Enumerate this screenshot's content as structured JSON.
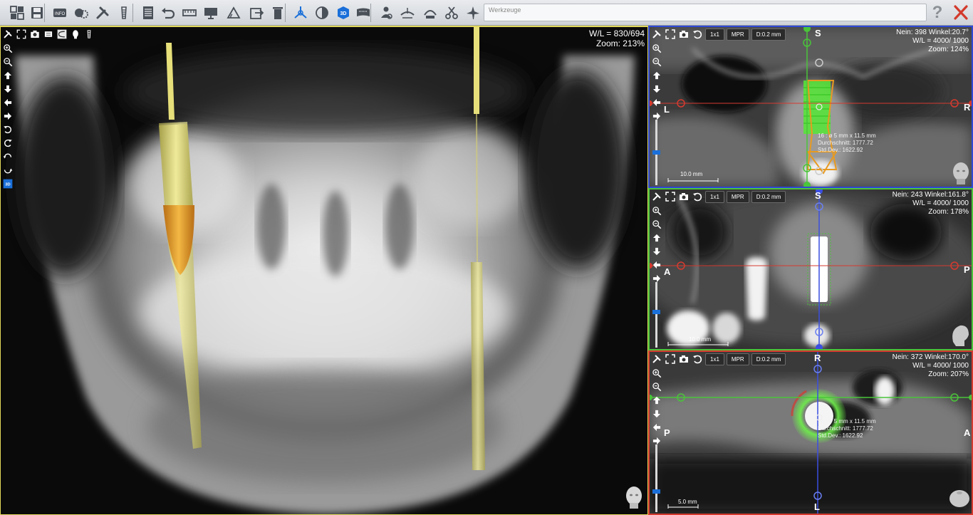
{
  "toolbar": {
    "icons": [
      "layout-icon",
      "save-icon",
      "info-icon",
      "settings-icon",
      "tools-icon",
      "implant-icon",
      "report-icon",
      "undo-icon",
      "ruler-icon",
      "screen-icon",
      "angle-icon",
      "export-icon",
      "delete-icon",
      "axis-3d-icon",
      "contrast-icon",
      "cube-3d-icon",
      "panorama-icon",
      "person-settings-icon",
      "nerve-icon",
      "camera-settings-icon",
      "scissors-icon",
      "airway-icon"
    ],
    "search_placeholder": "Werkzeuge",
    "help_label": "?"
  },
  "panorama": {
    "wl_text": "W/L = 830/694",
    "zoom_text": "Zoom: 213%",
    "tools": [
      "tools-icon",
      "fullscreen-icon",
      "camera-icon",
      "slab-icon",
      "curve-icon",
      "head-front-icon",
      "implant-small-icon"
    ],
    "side_tools": [
      "zoom-in-icon",
      "zoom-out-icon",
      "arrow-up-icon",
      "arrow-down-icon",
      "arrow-left-icon",
      "arrow-right-icon",
      "rotate-ccw-icon",
      "rotate-cw-icon",
      "rotate-ccw-alt-icon",
      "rotate-cw-alt-icon",
      "view-3d-icon"
    ]
  },
  "viewports": {
    "coronal": {
      "chips": [
        "1x1",
        "MPR",
        "D:0.2 mm"
      ],
      "info": [
        "Nein: 398 Winkel:20.7°",
        "W/L = 4000/ 1000",
        "Zoom: 124%"
      ],
      "orient_top": "S",
      "orient_left": "L",
      "orient_right": "R",
      "annotation": [
        "16 : ø 5 mm x 11.5 mm",
        "Durchschnitt: 1777.72",
        "Std.Dev.: 1622.92"
      ],
      "scale_label": "10.0 mm"
    },
    "sagittal": {
      "chips": [
        "1x1",
        "MPR",
        "D:0.2 mm"
      ],
      "info": [
        "Nein: 243 Winkel:161.8°",
        "W/L = 4000/ 1000",
        "Zoom: 178%"
      ],
      "orient_top": "S",
      "orient_left": "A",
      "orient_right": "P",
      "scale_label": "10.0 mm"
    },
    "axial": {
      "chips": [
        "1x1",
        "MPR",
        "D:0.2 mm"
      ],
      "info": [
        "Nein: 372 Winkel:170.0°",
        "W/L = 4000/ 1000",
        "Zoom: 207%"
      ],
      "orient_top": "R",
      "orient_bottom": "L",
      "orient_left": "P",
      "orient_right": "A",
      "annotation": [
        "16 : ø 5 mm x 11.5 mm",
        "Durchschnitt: 1777.72",
        "Std.Dev.: 1622.92"
      ],
      "scale_label": "5.0 mm"
    }
  },
  "colors": {
    "panorama_border": "#e2d95a",
    "coronal_border": "#2f48d6",
    "sagittal_border": "#4ac43a",
    "axial_border": "#d63a2f",
    "implant_green": "#5de83a",
    "implant_yellow": "#e8e07a",
    "implant_orange": "#e8a020"
  }
}
